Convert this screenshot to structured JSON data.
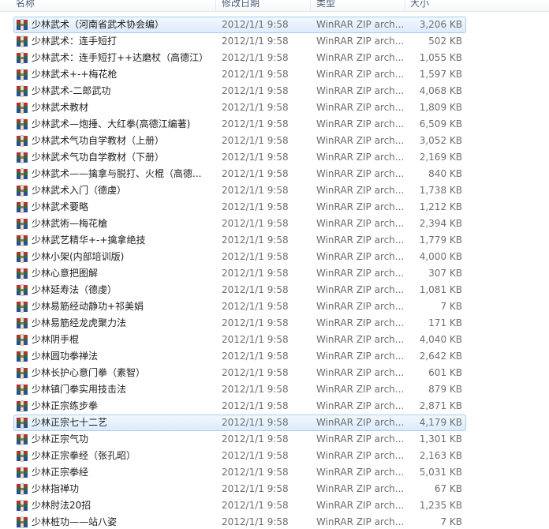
{
  "columns": {
    "name": "名称",
    "date": "修改日期",
    "type": "类型",
    "size": "大小"
  },
  "colors": {
    "selection_border": "#a7cdf0",
    "selection_fill": "#dcebfb",
    "secondary_text": "#6d6d6d"
  },
  "icon": "winrar-archive-icon",
  "files": [
    {
      "name": "少林武术（河南省武术协会编）",
      "date": "2012/1/1 9:58",
      "type": "WinRAR ZIP arch...",
      "size": "3,206 KB",
      "selected": true
    },
    {
      "name": "少林武术：连手短打",
      "date": "2012/1/1 9:58",
      "type": "WinRAR ZIP arch...",
      "size": "502 KB"
    },
    {
      "name": "少林武术：连手短打++达磨杖（高德江）",
      "date": "2012/1/1 9:58",
      "type": "WinRAR ZIP arch...",
      "size": "1,055 KB"
    },
    {
      "name": "少林武术+-+梅花枪",
      "date": "2012/1/1 9:58",
      "type": "WinRAR ZIP arch...",
      "size": "1,597 KB"
    },
    {
      "name": "少林武术-二郎武功",
      "date": "2012/1/1 9:58",
      "type": "WinRAR ZIP arch...",
      "size": "4,068 KB"
    },
    {
      "name": "少林武术教材",
      "date": "2012/1/1 9:58",
      "type": "WinRAR ZIP arch...",
      "size": "1,809 KB"
    },
    {
      "name": "少林武术—炮捶、大红拳(高德江编著)",
      "date": "2012/1/1 9:58",
      "type": "WinRAR ZIP arch...",
      "size": "6,509 KB"
    },
    {
      "name": "少林武术气功自学教材（上册）",
      "date": "2012/1/1 9:58",
      "type": "WinRAR ZIP arch...",
      "size": "3,052 KB"
    },
    {
      "name": "少林武术气功自学教材（下册）",
      "date": "2012/1/1 9:58",
      "type": "WinRAR ZIP arch...",
      "size": "2,169 KB"
    },
    {
      "name": "少林武术——擒拿与脱打、火棍（高德...",
      "date": "2012/1/1 9:58",
      "type": "WinRAR ZIP arch...",
      "size": "840 KB"
    },
    {
      "name": "少林武术入门（德虔）",
      "date": "2012/1/1 9:58",
      "type": "WinRAR ZIP arch...",
      "size": "1,738 KB"
    },
    {
      "name": "少林武术要略",
      "date": "2012/1/1 9:58",
      "type": "WinRAR ZIP arch...",
      "size": "1,212 KB"
    },
    {
      "name": "少林武術—梅花槍",
      "date": "2012/1/1 9:58",
      "type": "WinRAR ZIP arch...",
      "size": "2,394 KB"
    },
    {
      "name": "少林武艺精华+-+擒拿绝技",
      "date": "2012/1/1 9:58",
      "type": "WinRAR ZIP arch...",
      "size": "1,779 KB"
    },
    {
      "name": "少林小架(内部培训版)",
      "date": "2012/1/1 9:58",
      "type": "WinRAR ZIP arch...",
      "size": "4,000 KB"
    },
    {
      "name": "少林心意把图解",
      "date": "2012/1/1 9:58",
      "type": "WinRAR ZIP arch...",
      "size": "307 KB"
    },
    {
      "name": "少林延寿法（德虔）",
      "date": "2012/1/1 9:58",
      "type": "WinRAR ZIP arch...",
      "size": "1,081 KB"
    },
    {
      "name": "少林易筋经动静功+祁美娟",
      "date": "2012/1/1 9:58",
      "type": "WinRAR ZIP arch...",
      "size": "7 KB"
    },
    {
      "name": "少林易筋经龙虎聚力法",
      "date": "2012/1/1 9:58",
      "type": "WinRAR ZIP arch...",
      "size": "171 KB"
    },
    {
      "name": "少林阴手棍",
      "date": "2012/1/1 9:58",
      "type": "WinRAR ZIP arch...",
      "size": "4,040 KB"
    },
    {
      "name": "少林圆功拳禅法",
      "date": "2012/1/1 9:58",
      "type": "WinRAR ZIP arch...",
      "size": "2,642 KB"
    },
    {
      "name": "少林长护心意门拳（素智）",
      "date": "2012/1/1 9:58",
      "type": "WinRAR ZIP arch...",
      "size": "601 KB"
    },
    {
      "name": "少林镇门拳实用技击法",
      "date": "2012/1/1 9:58",
      "type": "WinRAR ZIP arch...",
      "size": "879 KB"
    },
    {
      "name": "少林正宗练步拳",
      "date": "2012/1/1 9:58",
      "type": "WinRAR ZIP arch...",
      "size": "2,871 KB"
    },
    {
      "name": "少林正宗七十二艺",
      "date": "2012/1/1 9:58",
      "type": "WinRAR ZIP arch...",
      "size": "4,179 KB",
      "selected": true
    },
    {
      "name": "少林正宗气功",
      "date": "2012/1/1 9:58",
      "type": "WinRAR ZIP arch...",
      "size": "1,301 KB"
    },
    {
      "name": "少林正宗拳经（张孔昭）",
      "date": "2012/1/1 9:58",
      "type": "WinRAR ZIP arch...",
      "size": "2,163 KB"
    },
    {
      "name": "少林正宗拳经",
      "date": "2012/1/1 9:58",
      "type": "WinRAR ZIP arch...",
      "size": "5,031 KB"
    },
    {
      "name": "少林指禅功",
      "date": "2012/1/1 9:58",
      "type": "WinRAR ZIP arch...",
      "size": "67 KB"
    },
    {
      "name": "少林肘法20招",
      "date": "2012/1/1 9:58",
      "type": "WinRAR ZIP arch...",
      "size": "1,235 KB"
    },
    {
      "name": "少林桩功——站八姿",
      "date": "2012/1/1 9:58",
      "type": "WinRAR ZIP arch...",
      "size": "7 KB"
    }
  ]
}
